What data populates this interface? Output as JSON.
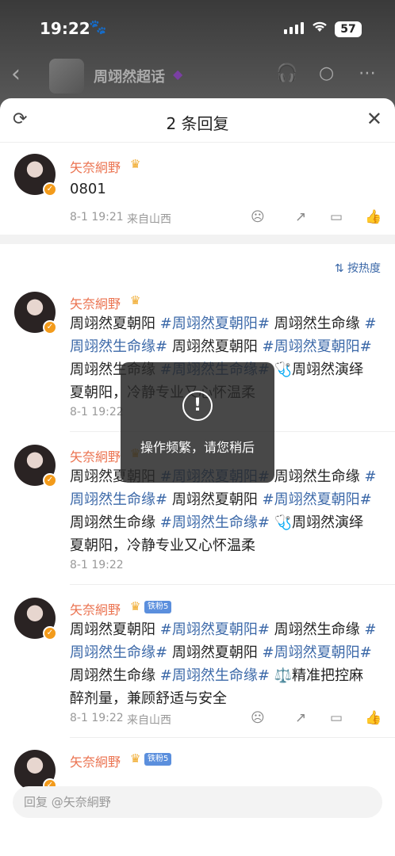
{
  "status": {
    "time": "19:22",
    "battery": "57"
  },
  "nav": {
    "title": "周翊然超话"
  },
  "sheet": {
    "title": "2 条回复"
  },
  "main_comment": {
    "user": "矢奈絅野",
    "text": "0801",
    "time": "8-1 19:21",
    "location": "来自山西"
  },
  "sort_label": "按热度",
  "replies": [
    {
      "user": "矢奈絅野",
      "badge": "",
      "lines": [
        [
          {
            "t": "周翊然夏朝阳 "
          },
          {
            "t": "#周翊然夏朝阳#",
            "tag": true
          },
          {
            "t": " 周翊然生命缘 "
          },
          {
            "t": "#",
            "tag": true
          }
        ],
        [
          {
            "t": "周翊然生命缘#",
            "tag": true
          },
          {
            "t": " 周翊然夏朝阳 "
          },
          {
            "t": "#周翊然夏朝阳#",
            "tag": true
          }
        ],
        [
          {
            "t": "周翊然生命缘 "
          },
          {
            "t": "#周翊然生命缘#",
            "tag": true
          },
          {
            "t": " 🩺周翊然演绎"
          }
        ],
        [
          {
            "t": "夏朝阳，冷静专业又心怀温柔"
          }
        ]
      ],
      "time": "8-1 19:22",
      "location": ""
    },
    {
      "user": "矢奈絅野",
      "badge": "",
      "lines": [
        [
          {
            "t": "周翊然夏朝阳 "
          },
          {
            "t": "#周翊然夏朝阳#",
            "tag": true
          },
          {
            "t": " 周翊然生命缘 "
          },
          {
            "t": "#",
            "tag": true
          }
        ],
        [
          {
            "t": "周翊然生命缘#",
            "tag": true
          },
          {
            "t": " 周翊然夏朝阳 "
          },
          {
            "t": "#周翊然夏朝阳#",
            "tag": true
          }
        ],
        [
          {
            "t": "周翊然生命缘 "
          },
          {
            "t": "#周翊然生命缘#",
            "tag": true
          },
          {
            "t": " 🩺周翊然演绎"
          }
        ],
        [
          {
            "t": "夏朝阳，冷静专业又心怀温柔"
          }
        ]
      ],
      "time": "8-1 19:22",
      "location": ""
    },
    {
      "user": "矢奈絅野",
      "badge": "铁粉5",
      "lines": [
        [
          {
            "t": "周翊然夏朝阳 "
          },
          {
            "t": "#周翊然夏朝阳#",
            "tag": true
          },
          {
            "t": " 周翊然生命缘 "
          },
          {
            "t": "#",
            "tag": true
          }
        ],
        [
          {
            "t": "周翊然生命缘#",
            "tag": true
          },
          {
            "t": " 周翊然夏朝阳 "
          },
          {
            "t": "#周翊然夏朝阳#",
            "tag": true
          }
        ],
        [
          {
            "t": "周翊然生命缘 "
          },
          {
            "t": "#周翊然生命缘#",
            "tag": true
          },
          {
            "t": " ⚖️精准把控麻"
          }
        ],
        [
          {
            "t": "醉剂量，兼顾舒适与安全"
          }
        ]
      ],
      "time": "8-1 19:22",
      "location": "来自山西"
    },
    {
      "user": "矢奈絅野",
      "badge": "铁粉5",
      "lines": [],
      "time": "",
      "location": ""
    }
  ],
  "toast": {
    "message": "操作频繁，请您稍后"
  },
  "reply_input": {
    "placeholder": "回复 @矢奈絅野"
  }
}
